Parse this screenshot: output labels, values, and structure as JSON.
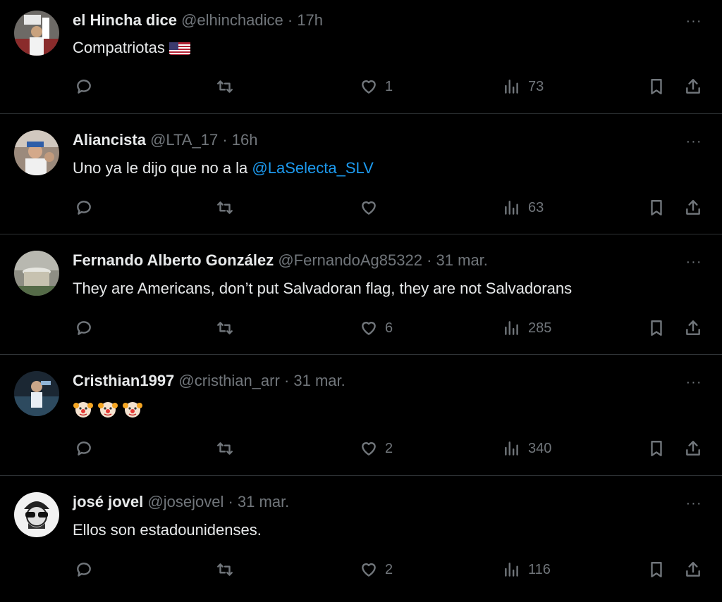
{
  "tweets": [
    {
      "name": "el Hincha dice",
      "handle": "@elhinchadice",
      "sep": "·",
      "time": "17h",
      "text": "Compatriotas",
      "has_flag": true,
      "reply_count": "",
      "retweet_count": "",
      "like_count": "1",
      "view_count": "73"
    },
    {
      "name": "Aliancista",
      "handle": "@LTA_17",
      "sep": "·",
      "time": "16h",
      "text": "Uno ya le dijo que no a la",
      "mention": "@LaSelecta_SLV",
      "reply_count": "",
      "retweet_count": "",
      "like_count": "",
      "view_count": "63"
    },
    {
      "name": "Fernando Alberto González",
      "handle": "@FernandoAg85322",
      "sep": "·",
      "time": "31 mar.",
      "text": "They are Americans, don’t put Salvadoran flag, they are not Salvadorans",
      "reply_count": "",
      "retweet_count": "",
      "like_count": "6",
      "view_count": "285"
    },
    {
      "name": "Cristhian1997",
      "handle": "@cristhian_arr",
      "sep": "·",
      "time": "31 mar.",
      "text": "",
      "emoji": [
        "clown-face",
        "clown-face",
        "clown-face"
      ],
      "reply_count": "",
      "retweet_count": "",
      "like_count": "2",
      "view_count": "340"
    },
    {
      "name": "josé jovel",
      "handle": "@josejovel",
      "sep": "·",
      "time": "31 mar.",
      "text": "Ellos son estadounidenses.",
      "reply_count": "",
      "retweet_count": "",
      "like_count": "2",
      "view_count": "116"
    }
  ],
  "more_label": "···",
  "colors": {
    "background": "#000000",
    "text": "#e7e9ea",
    "muted": "#71767b",
    "link": "#1d9bf0",
    "divider": "#2f3336"
  },
  "icons": [
    "reply-icon",
    "retweet-icon",
    "like-icon",
    "views-icon",
    "bookmark-icon",
    "share-icon",
    "more-icon"
  ]
}
